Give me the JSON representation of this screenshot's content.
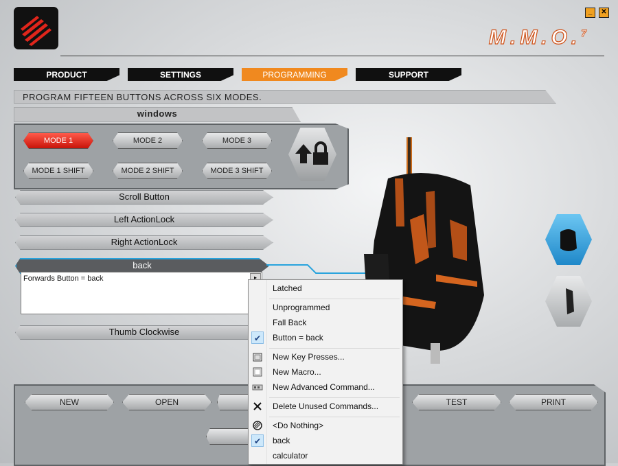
{
  "window": {
    "brand": "M.M.O.",
    "brand_sup": "7",
    "minimize_glyph": "_",
    "close_glyph": "✕"
  },
  "tabs": [
    {
      "label": "PRODUCT"
    },
    {
      "label": "SETTINGS"
    },
    {
      "label": "PROGRAMMING",
      "active": true
    },
    {
      "label": "SUPPORT"
    }
  ],
  "description": "PROGRAM FIFTEEN BUTTONS ACROSS SIX MODES.",
  "profile_name": "windows",
  "modes": [
    {
      "label": "MODE 1",
      "selected": true
    },
    {
      "label": "MODE 2"
    },
    {
      "label": "MODE 3"
    },
    {
      "label": "MODE 1 SHIFT"
    },
    {
      "label": "MODE 2 SHIFT"
    },
    {
      "label": "MODE 3 SHIFT"
    }
  ],
  "buttons": [
    {
      "label": "Scroll Button"
    },
    {
      "label": "Left ActionLock"
    },
    {
      "label": "Right ActionLock"
    },
    {
      "label": "back",
      "active": true
    },
    {
      "label": "Thumb Clockwise"
    }
  ],
  "detail_text": "Forwards Button = back",
  "footer_buttons": [
    {
      "label": "NEW"
    },
    {
      "label": "OPEN"
    },
    {
      "label": "TEST"
    },
    {
      "label": "PRINT"
    }
  ],
  "context_menu": {
    "items": [
      {
        "label": "Latched",
        "icon": "none"
      },
      {
        "label": "Unprogrammed",
        "icon": "none"
      },
      {
        "label": "Fall Back",
        "icon": "none"
      },
      {
        "label": "Button = back",
        "icon": "check-icon",
        "checked": true
      },
      {
        "label": "New Key Presses...",
        "icon": "keypress-icon"
      },
      {
        "label": "New Macro...",
        "icon": "macro-icon"
      },
      {
        "label": "New Advanced Command...",
        "icon": "advanced-command-icon"
      },
      {
        "label": "Delete Unused Commands...",
        "icon": "x-delete-icon"
      },
      {
        "label": "<Do Nothing>",
        "icon": "do-nothing-icon"
      },
      {
        "label": "back",
        "icon": "check-icon",
        "checked": true
      },
      {
        "label": "calculator",
        "icon": "none"
      }
    ]
  },
  "colors": {
    "accent_orange": "#f0891f",
    "mode_selected_red": "#d81f10",
    "active_outline_blue": "#28a3dd"
  }
}
